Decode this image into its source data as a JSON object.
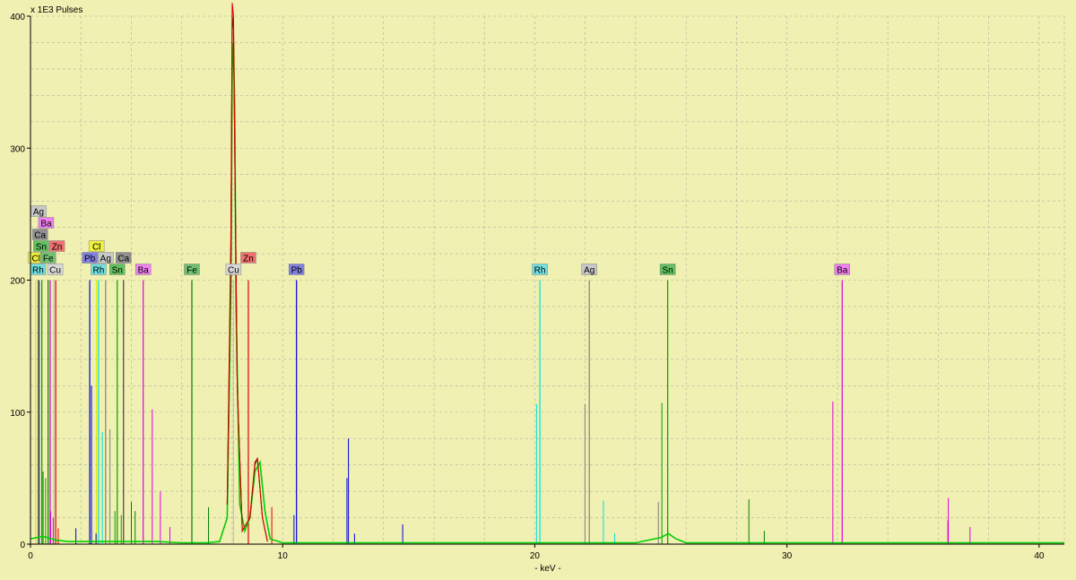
{
  "chart_data": {
    "type": "line",
    "title": "",
    "ylabel": "x 1E3 Pulses",
    "xlabel": "- keV -",
    "xlim": [
      0,
      41
    ],
    "ylim": [
      0,
      400
    ],
    "x_ticks": [
      0,
      10,
      20,
      30,
      40
    ],
    "y_ticks": [
      0,
      100,
      200,
      300,
      400
    ],
    "grid": true,
    "colors": {
      "background": "#f0f0b2",
      "grid": "#b0b0a0",
      "axis": "#000000"
    },
    "element_markers": [
      {
        "element": "Cl",
        "keV": 0.2,
        "height": 200,
        "color": "#e8e800"
      },
      {
        "element": "Rh",
        "keV": 0.35,
        "height": 200,
        "color": "#00e0e0"
      },
      {
        "element": "Fe",
        "keV": 0.7,
        "height": 200,
        "color": "#008000"
      },
      {
        "element": "Cu",
        "keV": 0.93,
        "height": 200,
        "color": "#c0c0c0"
      },
      {
        "element": "Sn",
        "keV": 0.45,
        "height": 200,
        "color": "#00a000"
      },
      {
        "element": "Zn",
        "keV": 1.0,
        "height": 200,
        "color": "#e00000"
      },
      {
        "element": "Ca",
        "keV": 0.34,
        "height": 200,
        "color": "#404040"
      },
      {
        "element": "Ba",
        "keV": 0.78,
        "height": 200,
        "color": "#e000e0"
      },
      {
        "element": "Ag",
        "keV": 0.3,
        "height": 200,
        "color": "#808080"
      },
      {
        "element": "Pb",
        "keV": 2.35,
        "height": 200,
        "color": "#0000e0"
      },
      {
        "element": "Rh",
        "keV": 2.7,
        "height": 200,
        "color": "#00e0e0"
      },
      {
        "element": "Ag",
        "keV": 2.98,
        "height": 200,
        "color": "#808080"
      },
      {
        "element": "Cl",
        "keV": 2.62,
        "height": 200,
        "color": "#e8e800"
      },
      {
        "element": "Sn",
        "keV": 3.44,
        "height": 200,
        "color": "#00a000"
      },
      {
        "element": "Ca",
        "keV": 3.69,
        "height": 200,
        "color": "#404040"
      },
      {
        "element": "Ba",
        "keV": 4.47,
        "height": 200,
        "color": "#e000e0"
      },
      {
        "element": "Fe",
        "keV": 6.4,
        "height": 200,
        "color": "#008000"
      },
      {
        "element": "Cu",
        "keV": 8.05,
        "height": 200,
        "color": "#c0c0c0"
      },
      {
        "element": "Zn",
        "keV": 8.64,
        "height": 200,
        "color": "#e00000"
      },
      {
        "element": "Pb",
        "keV": 10.55,
        "height": 200,
        "color": "#0000e0"
      },
      {
        "element": "Rh",
        "keV": 20.2,
        "height": 200,
        "color": "#00e0e0"
      },
      {
        "element": "Ag",
        "keV": 22.16,
        "height": 200,
        "color": "#808080"
      },
      {
        "element": "Sn",
        "keV": 25.27,
        "height": 200,
        "color": "#00a000"
      },
      {
        "element": "Ba",
        "keV": 32.19,
        "height": 200,
        "color": "#e000e0"
      }
    ],
    "marker_labels": [
      {
        "text": "Ag",
        "keV": 0.32,
        "row": 5,
        "color": "#c8c8c8"
      },
      {
        "text": "Ba",
        "keV": 0.62,
        "row": 4,
        "color": "#f080f0"
      },
      {
        "text": "Ca",
        "keV": 0.38,
        "row": 3,
        "color": "#909090"
      },
      {
        "text": "Sn",
        "keV": 0.42,
        "row": 2,
        "color": "#60c060"
      },
      {
        "text": "Zn",
        "keV": 1.05,
        "row": 2,
        "color": "#f07070"
      },
      {
        "text": "Cl",
        "keV": 0.22,
        "row": 1,
        "color": "#f0f040"
      },
      {
        "text": "Fe",
        "keV": 0.7,
        "row": 1,
        "color": "#70c070"
      },
      {
        "text": "Rh",
        "keV": 0.3,
        "row": 0,
        "color": "#70e0e0"
      },
      {
        "text": "Cu",
        "keV": 0.98,
        "row": 0,
        "color": "#d8d8d8"
      },
      {
        "text": "Cl",
        "keV": 2.62,
        "row": 2,
        "color": "#f0f040"
      },
      {
        "text": "Pb",
        "keV": 2.35,
        "row": 1,
        "color": "#8080e0"
      },
      {
        "text": "Ag",
        "keV": 2.98,
        "row": 1,
        "color": "#c8c8c8"
      },
      {
        "text": "Ca",
        "keV": 3.69,
        "row": 1,
        "color": "#909090"
      },
      {
        "text": "Rh",
        "keV": 2.7,
        "row": 0,
        "color": "#70e0e0"
      },
      {
        "text": "Sn",
        "keV": 3.44,
        "row": 0,
        "color": "#60c060"
      },
      {
        "text": "Ba",
        "keV": 4.47,
        "row": 0,
        "color": "#f080f0"
      },
      {
        "text": "Fe",
        "keV": 6.4,
        "row": 0,
        "color": "#70c070"
      },
      {
        "text": "Zn",
        "keV": 8.64,
        "row": 1,
        "color": "#f07070"
      },
      {
        "text": "Cu",
        "keV": 8.05,
        "row": 0,
        "color": "#d8d8d8"
      },
      {
        "text": "Pb",
        "keV": 10.55,
        "row": 0,
        "color": "#8080e0"
      },
      {
        "text": "Rh",
        "keV": 20.2,
        "row": 0,
        "color": "#70e0e0"
      },
      {
        "text": "Ag",
        "keV": 22.16,
        "row": 0,
        "color": "#c8c8c8"
      },
      {
        "text": "Sn",
        "keV": 25.27,
        "row": 0,
        "color": "#60c060"
      },
      {
        "text": "Ba",
        "keV": 32.19,
        "row": 0,
        "color": "#f080f0"
      }
    ],
    "minor_lines": [
      {
        "keV": 0.5,
        "height": 55,
        "color": "#008000"
      },
      {
        "keV": 0.6,
        "height": 50,
        "color": "#00a000"
      },
      {
        "keV": 0.8,
        "height": 25,
        "color": "#e000e0"
      },
      {
        "keV": 0.9,
        "height": 20,
        "color": "#e000e0"
      },
      {
        "keV": 1.1,
        "height": 12,
        "color": "#e00000"
      },
      {
        "keV": 1.8,
        "height": 12,
        "color": "#0000e0"
      },
      {
        "keV": 2.42,
        "height": 120,
        "color": "#0000e0"
      },
      {
        "keV": 2.6,
        "height": 8,
        "color": "#0000e0"
      },
      {
        "keV": 2.85,
        "height": 85,
        "color": "#00e0e0"
      },
      {
        "keV": 3.15,
        "height": 87,
        "color": "#808080"
      },
      {
        "keV": 3.35,
        "height": 25,
        "color": "#00a000"
      },
      {
        "keV": 3.6,
        "height": 22,
        "color": "#00a000"
      },
      {
        "keV": 4.0,
        "height": 32,
        "color": "#008000"
      },
      {
        "keV": 4.15,
        "height": 25,
        "color": "#008000"
      },
      {
        "keV": 4.83,
        "height": 102,
        "color": "#e000e0"
      },
      {
        "keV": 5.15,
        "height": 40,
        "color": "#e000e0"
      },
      {
        "keV": 5.53,
        "height": 13,
        "color": "#e000e0"
      },
      {
        "keV": 7.06,
        "height": 28,
        "color": "#008000"
      },
      {
        "keV": 9.57,
        "height": 28,
        "color": "#e00000"
      },
      {
        "keV": 10.45,
        "height": 22,
        "color": "#0000e0"
      },
      {
        "keV": 12.61,
        "height": 80,
        "color": "#0000e0"
      },
      {
        "keV": 12.55,
        "height": 50,
        "color": "#0000e0"
      },
      {
        "keV": 12.85,
        "height": 8,
        "color": "#0000e0"
      },
      {
        "keV": 14.76,
        "height": 15,
        "color": "#0000e0"
      },
      {
        "keV": 20.07,
        "height": 106,
        "color": "#00e0e0"
      },
      {
        "keV": 21.99,
        "height": 106,
        "color": "#808080"
      },
      {
        "keV": 22.72,
        "height": 33,
        "color": "#00e0e0"
      },
      {
        "keV": 23.17,
        "height": 8,
        "color": "#00e0e0"
      },
      {
        "keV": 25.04,
        "height": 107,
        "color": "#00a000"
      },
      {
        "keV": 24.9,
        "height": 32,
        "color": "#808080"
      },
      {
        "keV": 28.49,
        "height": 34,
        "color": "#008000"
      },
      {
        "keV": 29.1,
        "height": 10,
        "color": "#008000"
      },
      {
        "keV": 31.82,
        "height": 108,
        "color": "#e000e0"
      },
      {
        "keV": 36.38,
        "height": 18,
        "color": "#e000e0"
      },
      {
        "keV": 36.4,
        "height": 35,
        "color": "#e000e0"
      },
      {
        "keV": 37.26,
        "height": 13,
        "color": "#e000e0"
      }
    ],
    "series": [
      {
        "color": "#00d000",
        "x": [
          0,
          0.5,
          1,
          1.5,
          2,
          3,
          4,
          5,
          6,
          7,
          7.5,
          7.8,
          7.95,
          8.0,
          8.05,
          8.1,
          8.15,
          8.3,
          8.5,
          8.7,
          8.9,
          9.1,
          9.3,
          9.5,
          10,
          11,
          12,
          14,
          16,
          18,
          20,
          22,
          24,
          25,
          25.3,
          25.6,
          26,
          28,
          30,
          35,
          41
        ],
        "y": [
          4,
          6,
          3,
          2,
          2,
          2,
          2,
          2,
          1,
          1,
          2,
          20,
          200,
          360,
          380,
          330,
          180,
          30,
          10,
          20,
          55,
          62,
          25,
          4,
          1,
          1,
          1,
          1,
          1,
          1,
          1,
          1,
          1,
          5,
          8,
          4,
          1,
          1,
          1,
          1,
          1
        ]
      },
      {
        "color": "#004000",
        "x": [
          7.8,
          7.95,
          8.0,
          8.05,
          8.1,
          8.2,
          8.4,
          8.7,
          8.9,
          9.0,
          9.2,
          9.4
        ],
        "y": [
          30,
          220,
          400,
          390,
          300,
          120,
          10,
          20,
          60,
          65,
          20,
          2
        ]
      },
      {
        "color": "#e00000",
        "x": [
          7.8,
          7.95,
          8.0,
          8.05,
          8.1,
          8.2,
          8.4,
          8.7,
          8.9,
          9.0,
          9.2,
          9.4
        ],
        "y": [
          30,
          240,
          410,
          400,
          300,
          120,
          10,
          20,
          62,
          65,
          20,
          2
        ]
      }
    ]
  }
}
